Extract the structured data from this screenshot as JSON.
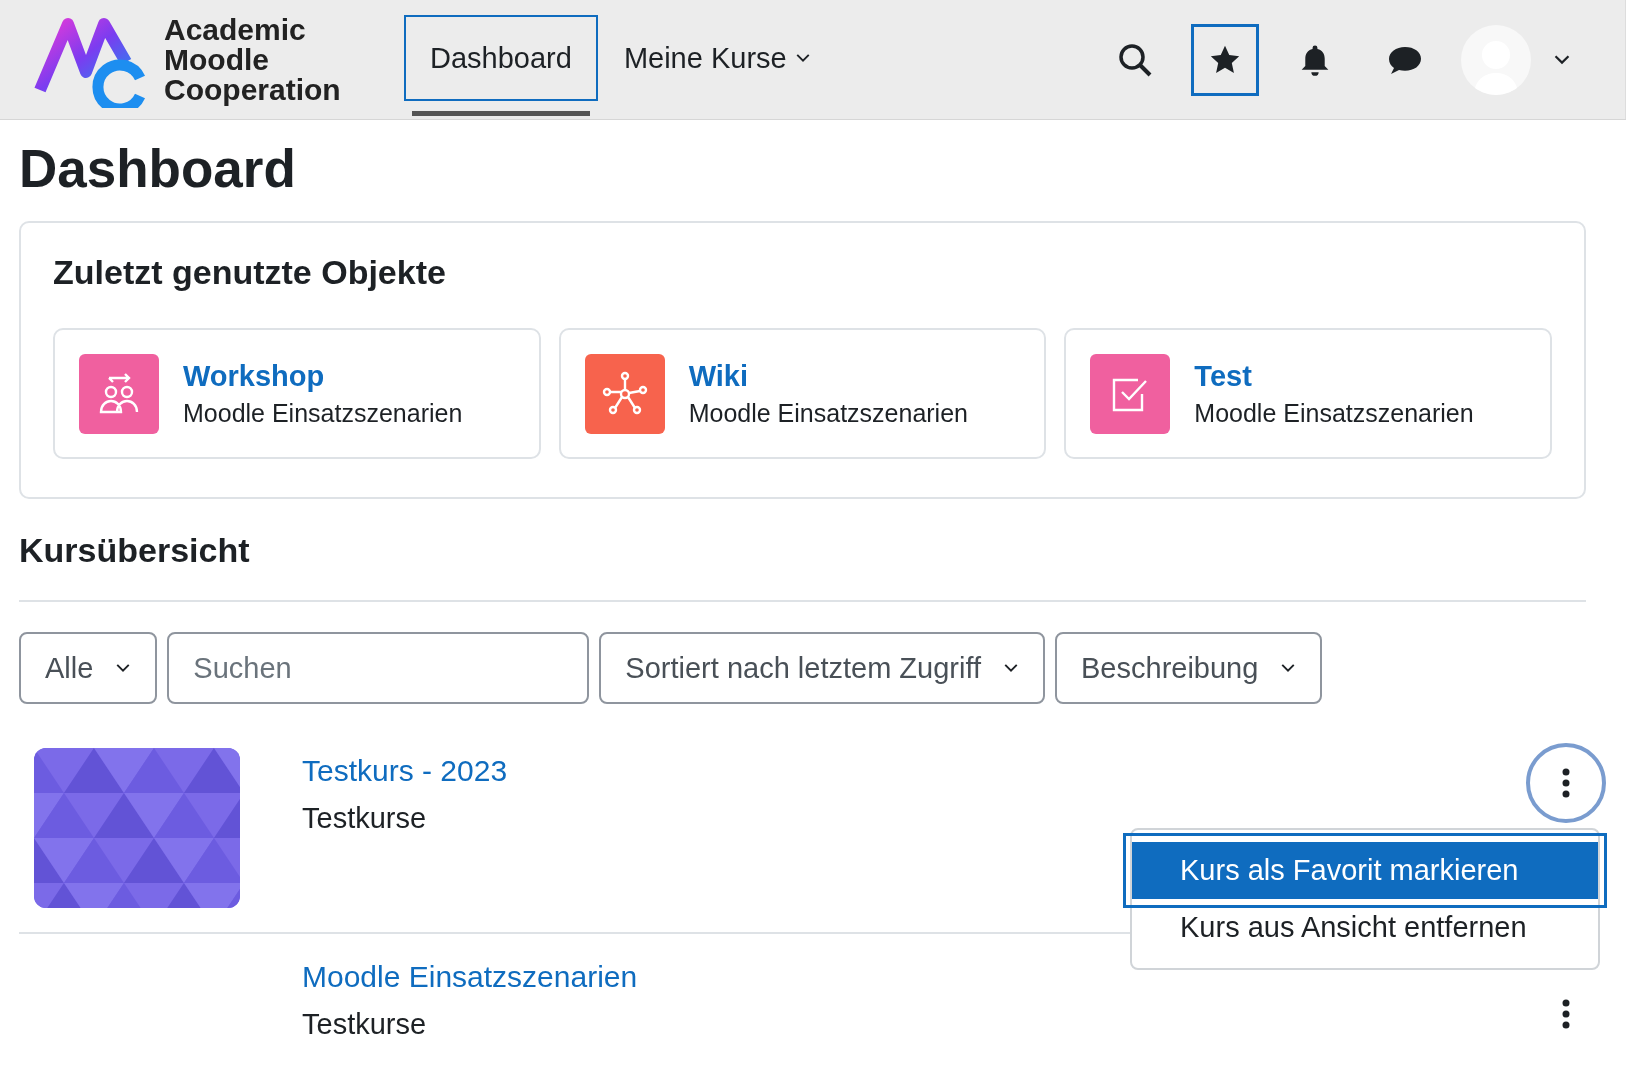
{
  "header": {
    "logo_lines": [
      "Academic",
      "Moodle",
      "Cooperation"
    ],
    "nav": [
      {
        "label": "Dashboard",
        "selected": true,
        "kind": "link"
      },
      {
        "label": "Meine Kurse",
        "selected": false,
        "kind": "dropdown"
      }
    ],
    "favourites_focused": true
  },
  "page_title": "Dashboard",
  "recent": {
    "title": "Zuletzt genutzte Objekte",
    "items": [
      {
        "name": "Workshop",
        "course": "Moodle Einsatzszenarien",
        "kind": "workshop",
        "color": "#f0609f"
      },
      {
        "name": "Wiki",
        "course": "Moodle Einsatzszenarien",
        "kind": "wiki",
        "color": "#f7634d"
      },
      {
        "name": "Test",
        "course": "Moodle Einsatzszenarien",
        "kind": "quiz",
        "color": "#f0609f"
      }
    ]
  },
  "overview": {
    "title": "Kursübersicht",
    "filters": [
      {
        "kind": "select",
        "value": "Alle"
      },
      {
        "kind": "search",
        "placeholder": "Suchen"
      },
      {
        "kind": "select",
        "value": "Sortiert nach letztem Zugriff"
      },
      {
        "kind": "select",
        "value": "Beschreibung"
      }
    ],
    "courses": [
      {
        "name": "Testkurs - 2023",
        "category": "Testkurse",
        "has_image": true,
        "menu_open": true
      },
      {
        "name": "Moodle Einsatzszenarien",
        "category": "Testkurse",
        "has_image": false,
        "menu_open": false
      }
    ],
    "menu": [
      {
        "label": "Kurs als Favorit markieren",
        "selected": true
      },
      {
        "label": "Kurs aus Ansicht entfernen",
        "selected": false
      }
    ]
  }
}
